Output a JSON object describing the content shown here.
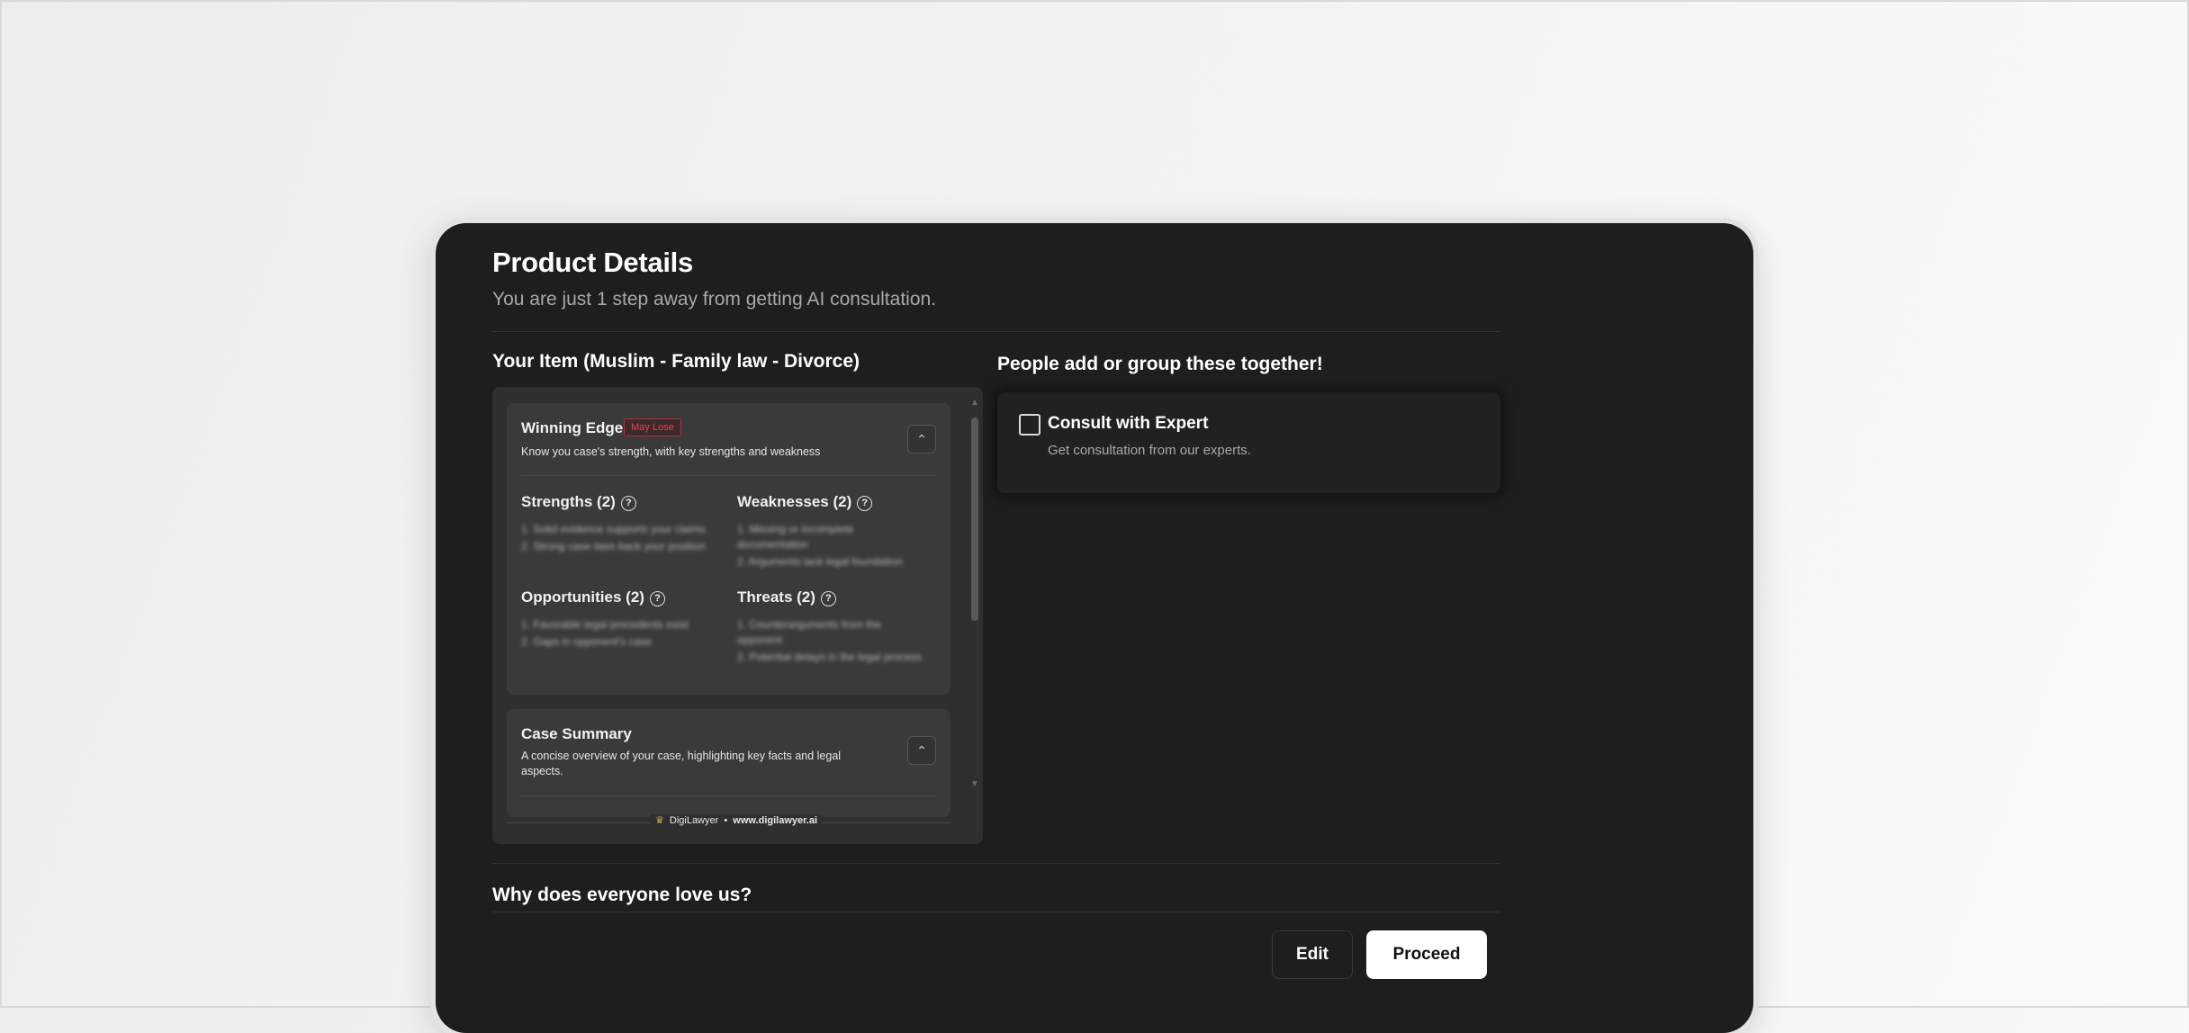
{
  "header": {
    "title": "Product Details",
    "subtitle": "You are just 1 step away from getting AI consultation."
  },
  "your_item": {
    "heading": "Your Item (Muslim - Family law - Divorce)",
    "winning_edge": {
      "title": "Winning Edge",
      "badge": "May Lose",
      "description": "Know you case's strength, with key strengths and weakness",
      "toggle_icon": "chevron-up-icon",
      "sections": {
        "strengths": {
          "title": "Strengths (2)",
          "items": [
            "1. Solid evidence supports your claims",
            "2. Strong case laws back your position"
          ]
        },
        "weaknesses": {
          "title": "Weaknesses (2)",
          "items": [
            "1. Missing or incomplete documentation",
            "2. Arguments lack legal foundation"
          ]
        },
        "opportunities": {
          "title": "Opportunities (2)",
          "items": [
            "1. Favorable legal precedents exist",
            "2. Gaps in opponent's case"
          ]
        },
        "threats": {
          "title": "Threats (2)",
          "items": [
            "1. Counterarguments from the opponent",
            "2. Potential delays in the legal process"
          ]
        }
      }
    },
    "case_summary": {
      "title": "Case Summary",
      "description": "A concise overview of your case, highlighting key facts and legal aspects.",
      "toggle_icon": "chevron-up-icon"
    },
    "footer": {
      "brand": "DigiLawyer",
      "separator": "•",
      "url": "www.digilawyer.ai"
    }
  },
  "upsell": {
    "heading": "People add or group these together!",
    "option": {
      "title": "Consult with Expert",
      "description": "Get consultation from our experts.",
      "checked": false
    }
  },
  "why": {
    "heading": "Why does everyone love us?"
  },
  "actions": {
    "edit_label": "Edit",
    "proceed_label": "Proceed"
  },
  "colors": {
    "modal_bg": "#1e1e1e",
    "panel_bg": "#2f2f2f",
    "card_bg": "#3a3a3a",
    "badge_red": "#e0444a",
    "primary_button": "#ffffff"
  }
}
